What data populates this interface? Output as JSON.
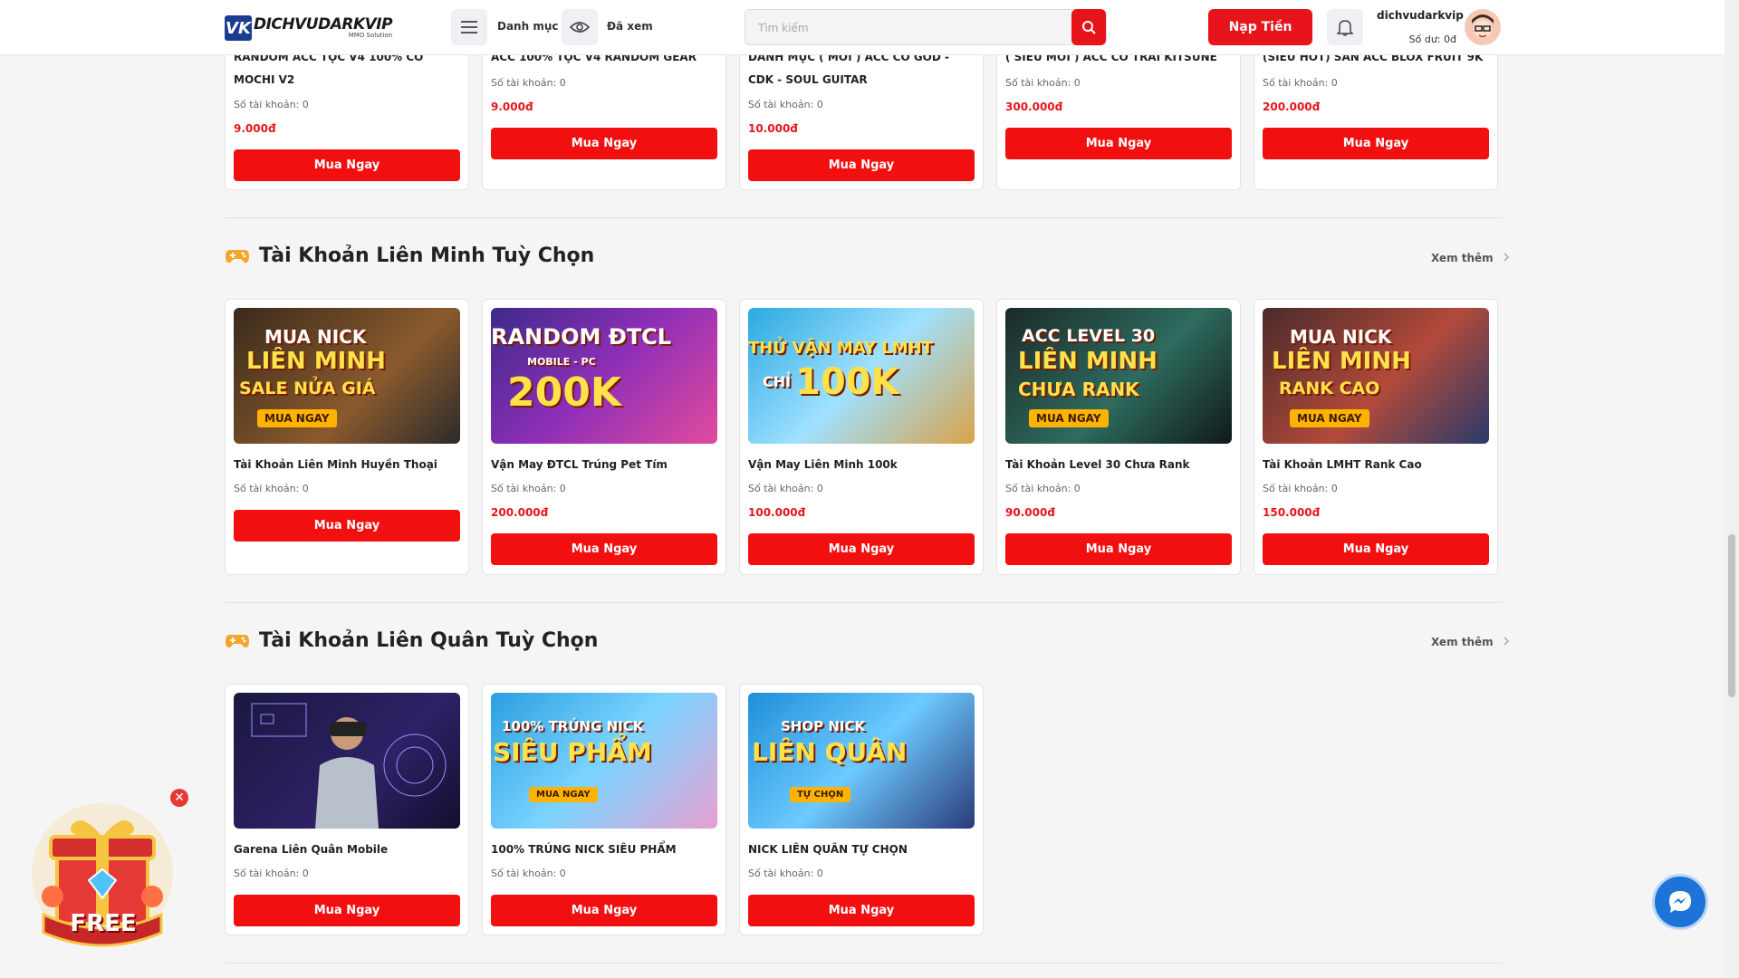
{
  "header": {
    "logo_main": "DICHVUDARKVIP",
    "logo_sub": "MMO Solution",
    "menu_label": "Danh mục",
    "seen_label": "Đã xem",
    "search_placeholder": "Tìm kiếm",
    "topup_label": "Nạp Tiền",
    "username": "dichvudarkvip",
    "balance": "Số dư: 0đ"
  },
  "top_row": [
    {
      "title": "RANDOM ACC TỘC V4 100% CÓ MOCHI V2",
      "count": "Số tài khoản: 0",
      "price": "9.000đ",
      "button": "Mua Ngay"
    },
    {
      "title": "ACC 100% TỘC V4 RANDOM GEAR",
      "count": "Số tài khoản: 0",
      "price": "9.000đ",
      "button": "Mua Ngay"
    },
    {
      "title": "DANH MỤC ( MỚI ) ACC CÓ GOD - CDK - SOUL GUITAR",
      "count": "Số tài khoản: 0",
      "price": "10.000đ",
      "button": "Mua Ngay"
    },
    {
      "title": "( SIÊU MỚI ) ACC CÓ TRÁI KITSUNE",
      "count": "Số tài khoản: 0",
      "price": "300.000đ",
      "button": "Mua Ngay"
    },
    {
      "title": "(SIÊU HOT) SĂN ACC BLOX FRUIT 9K",
      "count": "Số tài khoản: 0",
      "price": "200.000đ",
      "button": "Mua Ngay"
    }
  ],
  "section_lmht": {
    "title": "Tài Khoản Liên Minh Tuỳ Chọn",
    "more": "Xem thêm",
    "items": [
      {
        "title": "Tài Khoản Liên Minh Huyền Thoại",
        "count": "Số tài khoản: 0",
        "price": "",
        "button": "Mua Ngay",
        "banner": [
          "MUA NICK",
          "LIÊN MINH",
          "SALE NỬA GIÁ",
          "MUA NGAY"
        ]
      },
      {
        "title": "Vận May ĐTCL Trúng Pet Tím",
        "count": "Số tài khoản: 0",
        "price": "200.000đ",
        "button": "Mua Ngay",
        "banner": [
          "RANDOM ĐTCL",
          "MOBILE - PC",
          "200K"
        ]
      },
      {
        "title": "Vận May Liên Minh 100k",
        "count": "Số tài khoản: 0",
        "price": "100.000đ",
        "button": "Mua Ngay",
        "banner": [
          "THỬ VẬN MAY LMHT",
          "CHỈ",
          "100K"
        ]
      },
      {
        "title": "Tài Khoản Level 30 Chưa Rank",
        "count": "Số tài khoản: 0",
        "price": "90.000đ",
        "button": "Mua Ngay",
        "banner": [
          "ACC LEVEL 30",
          "LIÊN MINH",
          "CHƯA RANK",
          "MUA NGAY"
        ]
      },
      {
        "title": "Tài Khoản LMHT Rank Cao",
        "count": "Số tài khoản: 0",
        "price": "150.000đ",
        "button": "Mua Ngay",
        "banner": [
          "MUA NICK",
          "LIÊN MINH",
          "RANK CAO",
          "MUA NGAY"
        ]
      }
    ]
  },
  "section_lq": {
    "title": "Tài Khoản Liên Quân Tuỳ Chọn",
    "more": "Xem thêm",
    "items": [
      {
        "title": "Garena Liên Quân Mobile",
        "count": "Số tài khoản: 0",
        "button": "Mua Ngay"
      },
      {
        "title": "100% TRÚNG NICK SIÊU PHẨM",
        "count": "Số tài khoản: 0",
        "button": "Mua Ngay",
        "banner": [
          "100% TRÚNG NICK",
          "SIÊU PHẨM",
          "MUA NGAY"
        ]
      },
      {
        "title": "NICK LIÊN QUÂN TỰ CHỌN",
        "count": "Số tài khoản: 0",
        "button": "Mua Ngay",
        "banner": [
          "SHOP NICK",
          "LIÊN QUÂN",
          "TỰ CHỌN"
        ]
      }
    ]
  },
  "gift": {
    "label": "FREE"
  },
  "icons": [
    "menu-icon",
    "eye-icon",
    "search-icon",
    "bell-icon",
    "gamepad-icon",
    "chevron-right-icon",
    "close-icon",
    "messenger-icon"
  ],
  "colors": {
    "accent": "#e8141b",
    "messenger": "#1e73d9"
  }
}
